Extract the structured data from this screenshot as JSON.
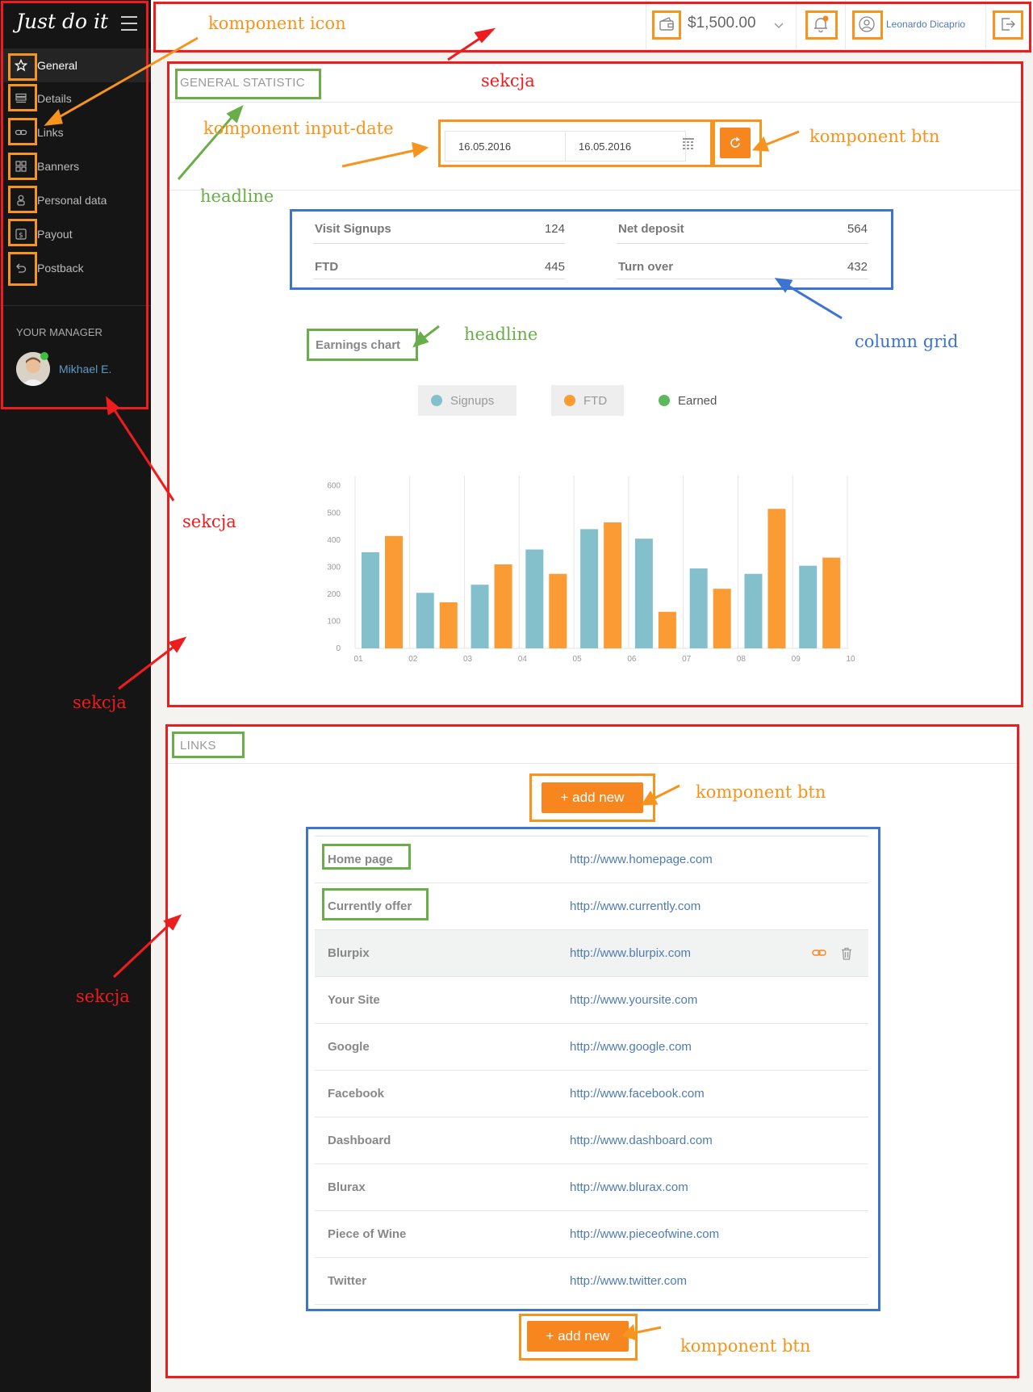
{
  "app": {
    "logo": "Just do it"
  },
  "sidebar": {
    "items": [
      {
        "label": "General",
        "icon": "star-icon",
        "active": true
      },
      {
        "label": "Details",
        "icon": "details-icon"
      },
      {
        "label": "Links",
        "icon": "link-icon"
      },
      {
        "label": "Banners",
        "icon": "grid-icon"
      },
      {
        "label": "Personal data",
        "icon": "person-icon"
      },
      {
        "label": "Payout",
        "icon": "dollar-icon"
      },
      {
        "label": "Postback",
        "icon": "back-arrow-icon"
      }
    ],
    "manager_title": "YOUR MANAGER",
    "manager_name": "Mikhael E."
  },
  "header": {
    "balance": "$1,500.00",
    "username": "Leonardo Dicaprio"
  },
  "general": {
    "title": "GENERAL STATISTIC",
    "date_from": "16.05.2016",
    "date_to": "16.05.2016",
    "stats": [
      {
        "label": "Visit Signups",
        "value": "124"
      },
      {
        "label": "Net deposit",
        "value": "564"
      },
      {
        "label": "FTD",
        "value": "445"
      },
      {
        "label": "Turn over",
        "value": "432"
      }
    ],
    "chart_title": "Earnings chart",
    "legend": [
      {
        "label": "Signups",
        "color": "#83c0cc"
      },
      {
        "label": "FTD",
        "color": "#fb9b34"
      },
      {
        "label": "Earned",
        "color": "#5cb85c"
      }
    ]
  },
  "chart_data": {
    "type": "bar",
    "categories": [
      "01",
      "02",
      "03",
      "04",
      "05",
      "06",
      "07",
      "08",
      "09"
    ],
    "x_ticks": [
      "01",
      "02",
      "03",
      "04",
      "05",
      "06",
      "07",
      "08",
      "09",
      "10"
    ],
    "series": [
      {
        "name": "Signups",
        "color": "#83c0cc",
        "values": [
          355,
          205,
          235,
          365,
          440,
          405,
          295,
          275,
          305
        ]
      },
      {
        "name": "FTD",
        "color": "#fb9b34",
        "values": [
          415,
          170,
          310,
          275,
          465,
          135,
          220,
          515,
          335
        ]
      }
    ],
    "y_ticks": [
      0,
      100,
      200,
      300,
      400,
      500,
      600
    ],
    "ylim": [
      0,
      620
    ],
    "grid": "vertical"
  },
  "links": {
    "title": "LINKS",
    "add_label": "+ add new",
    "rows": [
      {
        "name": "Home page",
        "url": "http://www.homepage.com"
      },
      {
        "name": "Currently offer",
        "url": "http://www.currently.com"
      },
      {
        "name": "Blurpix",
        "url": "http://www.blurpix.com",
        "highlighted": true
      },
      {
        "name": "Your Site",
        "url": "http://www.yoursite.com"
      },
      {
        "name": "Google",
        "url": "http://www.google.com"
      },
      {
        "name": "Facebook",
        "url": "http://www.facebook.com"
      },
      {
        "name": "Dashboard",
        "url": "http://www.dashboard.com"
      },
      {
        "name": "Blurax",
        "url": "http://www.blurax.com"
      },
      {
        "name": "Piece of Wine",
        "url": "http://www.pieceofwine.com"
      },
      {
        "name": "Twitter",
        "url": "http://www.twitter.com"
      }
    ]
  },
  "annotations": {
    "icon_component": "komponent icon",
    "section": "sekcja",
    "input_date": "komponent input-date",
    "btn_component": "komponent btn",
    "headline": "headline",
    "column_grid": "column grid"
  }
}
